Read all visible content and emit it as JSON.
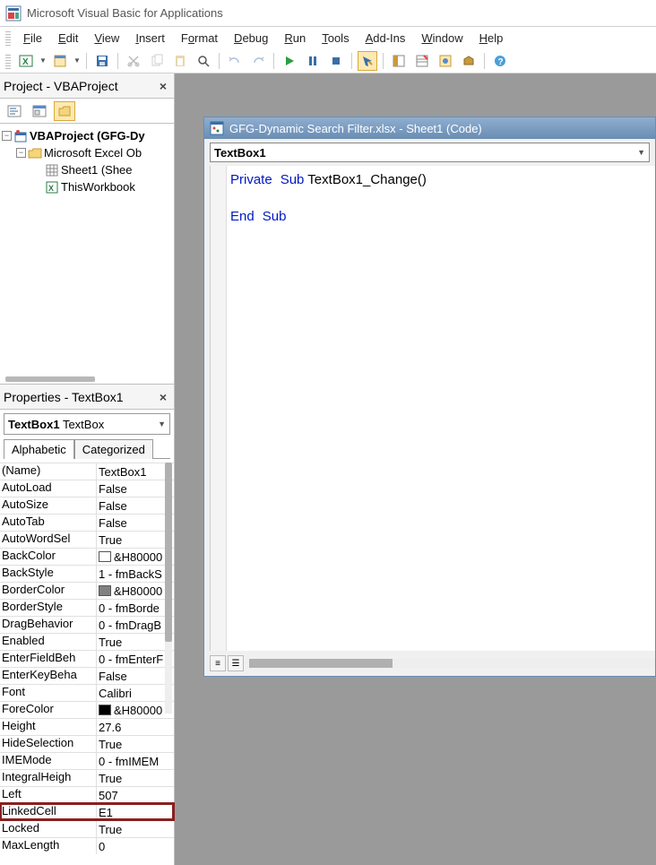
{
  "app": {
    "title": "Microsoft Visual Basic for Applications"
  },
  "menu": {
    "file": "File",
    "edit": "Edit",
    "view": "View",
    "insert": "Insert",
    "format": "Format",
    "debug": "Debug",
    "run": "Run",
    "tools": "Tools",
    "addins": "Add-Ins",
    "window": "Window",
    "help": "Help"
  },
  "project": {
    "title": "Project - VBAProject",
    "root": "VBAProject (GFG-Dy",
    "excel_objects": "Microsoft Excel Ob",
    "sheet1": "Sheet1 (Shee",
    "workbook": "ThisWorkbook"
  },
  "properties_pane": {
    "title": "Properties - TextBox1",
    "object_name": "TextBox1",
    "object_type": "TextBox",
    "tab_alpha": "Alphabetic",
    "tab_cat": "Categorized",
    "rows": [
      {
        "name": "(Name)",
        "value": "TextBox1"
      },
      {
        "name": "AutoLoad",
        "value": "False"
      },
      {
        "name": "AutoSize",
        "value": "False"
      },
      {
        "name": "AutoTab",
        "value": "False"
      },
      {
        "name": "AutoWordSel",
        "value": "True"
      },
      {
        "name": "BackColor",
        "value": "&H80000",
        "swatch": "#ffffff"
      },
      {
        "name": "BackStyle",
        "value": "1 - fmBackS"
      },
      {
        "name": "BorderColor",
        "value": "&H80000",
        "swatch": "#808080"
      },
      {
        "name": "BorderStyle",
        "value": "0 - fmBorde"
      },
      {
        "name": "DragBehavior",
        "value": "0 - fmDragB"
      },
      {
        "name": "Enabled",
        "value": "True"
      },
      {
        "name": "EnterFieldBeh",
        "value": "0 - fmEnterF"
      },
      {
        "name": "EnterKeyBeha",
        "value": "False"
      },
      {
        "name": "Font",
        "value": "Calibri"
      },
      {
        "name": "ForeColor",
        "value": "&H80000",
        "swatch": "#000000"
      },
      {
        "name": "Height",
        "value": "27.6"
      },
      {
        "name": "HideSelection",
        "value": "True"
      },
      {
        "name": "IMEMode",
        "value": "0 - fmIMEM"
      },
      {
        "name": "IntegralHeigh",
        "value": "True"
      },
      {
        "name": "Left",
        "value": "507"
      },
      {
        "name": "LinkedCell",
        "value": "E1",
        "highlight": true
      },
      {
        "name": "Locked",
        "value": "True"
      },
      {
        "name": "MaxLength",
        "value": "0"
      }
    ]
  },
  "code_window": {
    "title": "GFG-Dynamic Search Filter.xlsx - Sheet1 (Code)",
    "object_selector": "TextBox1",
    "line1_kw1": "Private",
    "line1_kw2": "Sub",
    "line1_rest": " TextBox1_Change()",
    "line3_kw1": "End",
    "line3_kw2": "Sub"
  }
}
